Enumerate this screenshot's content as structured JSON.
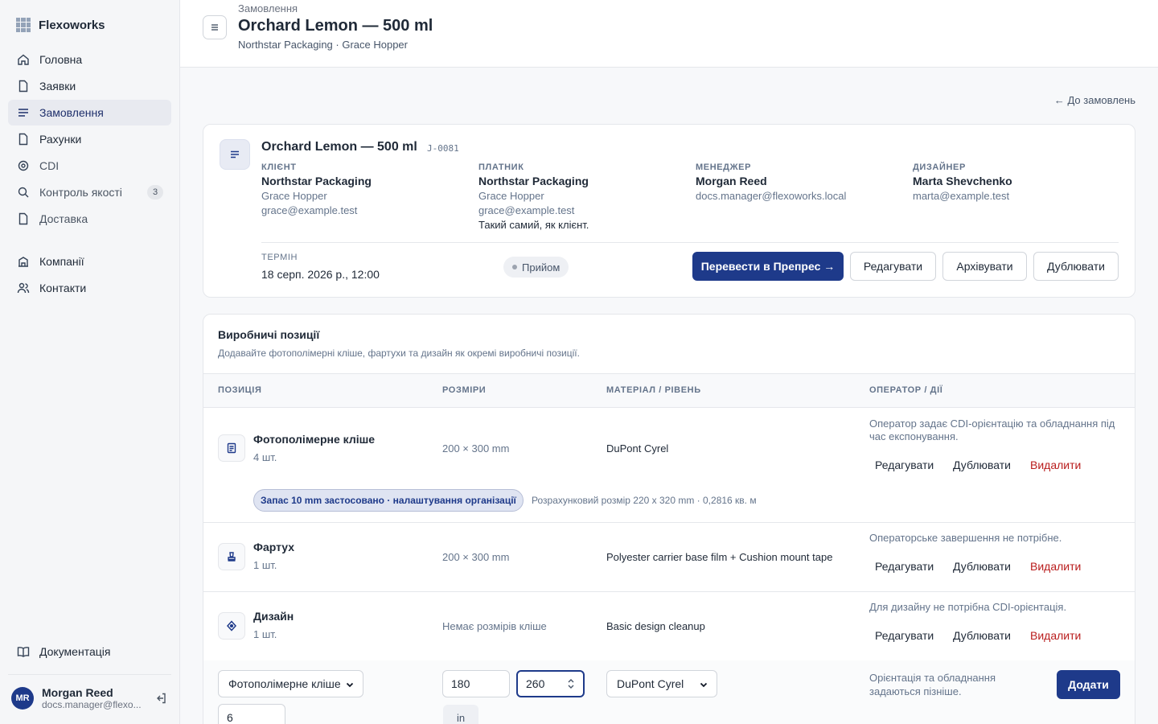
{
  "app": {
    "name": "Flexoworks"
  },
  "sidebar": {
    "items": [
      {
        "label": "Головна",
        "icon": "home-icon"
      },
      {
        "label": "Заявки",
        "icon": "file-icon"
      },
      {
        "label": "Замовлення",
        "icon": "list-icon",
        "active": true
      },
      {
        "label": "Рахунки",
        "icon": "file-icon"
      },
      {
        "label": "CDI",
        "icon": "target-icon"
      },
      {
        "label": "Контроль якості",
        "icon": "search-icon",
        "badge": "3"
      },
      {
        "label": "Доставка",
        "icon": "truck-icon"
      }
    ],
    "secondary": [
      {
        "label": "Компанії",
        "icon": "building-icon"
      },
      {
        "label": "Контакти",
        "icon": "users-icon"
      }
    ],
    "docs_label": "Документація",
    "user": {
      "initials": "MR",
      "name": "Morgan Reed",
      "email": "docs.manager@flexo..."
    }
  },
  "header": {
    "breadcrumb": "Замовлення",
    "title": "Orchard Lemon — 500 ml",
    "subtitle": "Northstar Packaging · Grace Hopper"
  },
  "back_link": "← До замовлень",
  "order": {
    "title": "Orchard Lemon — 500 ml",
    "code": "J-0081",
    "client": {
      "label": "Клієнт",
      "name": "Northstar Packaging",
      "contact": "Grace Hopper",
      "email": "grace@example.test"
    },
    "payer": {
      "label": "Платник",
      "name": "Northstar Packaging",
      "contact": "Grace Hopper",
      "email": "grace@example.test",
      "note": "Такий самий, як клієнт."
    },
    "manager": {
      "label": "Менеджер",
      "name": "Morgan Reed",
      "email": "docs.manager@flexoworks.local"
    },
    "designer": {
      "label": "Дизайнер",
      "name": "Marta Shevchenko",
      "email": "marta@example.test"
    },
    "deadline_label": "Термін",
    "deadline": "18 серп. 2026 р., 12:00",
    "status": "Прийом",
    "actions": {
      "primary": "Перевести в Препрес →",
      "edit": "Редагувати",
      "archive": "Архівувати",
      "duplicate": "Дублювати"
    }
  },
  "positions": {
    "title": "Виробничі позиції",
    "description": "Додавайте фотополімерні кліше, фартухи та дизайн як окремі виробничі позиції.",
    "columns": [
      "Позиція",
      "Розміри",
      "Матеріал / рівень",
      "Оператор / дії"
    ],
    "rows": [
      {
        "name": "Фотополімерне кліше",
        "qty": "4 шт.",
        "icon": "document-icon",
        "size": "200 × 300 mm",
        "material": "DuPont Cyrel",
        "note": "Оператор задає CDI-орієнтацію та обладнання під час експонування.",
        "margin_pill": "Запас 10 mm застосовано · налаштування організації",
        "calc_note": "Розрахунковий розмір 220 x 320 mm · 0,2816 кв. м"
      },
      {
        "name": "Фартух",
        "qty": "1 шт.",
        "icon": "stamp-icon",
        "size": "200 × 300 mm",
        "material": "Polyester carrier base film + Cushion mount tape",
        "note": "Операторське завершення не потрібне."
      },
      {
        "name": "Дизайн",
        "qty": "1 шт.",
        "icon": "pen-tool-icon",
        "size": "Немає розмірів кліше",
        "material": "Basic design cleanup",
        "note": "Для дизайну не потрібна CDI-орієнтація."
      }
    ],
    "row_actions": {
      "edit": "Редагувати",
      "duplicate": "Дублювати",
      "delete": "Видалити"
    },
    "add_form": {
      "type_value": "Фотополімерне кліше",
      "width": "180",
      "height": "260",
      "unit": "in",
      "material_value": "DuPont Cyrel",
      "qty": "6",
      "note": "Орієнтація та обладнання задаються пізніше.",
      "submit": "Додати"
    }
  },
  "colors": {
    "primary": "#1e3a8a",
    "danger": "#b91c1c",
    "muted": "#64748b"
  }
}
